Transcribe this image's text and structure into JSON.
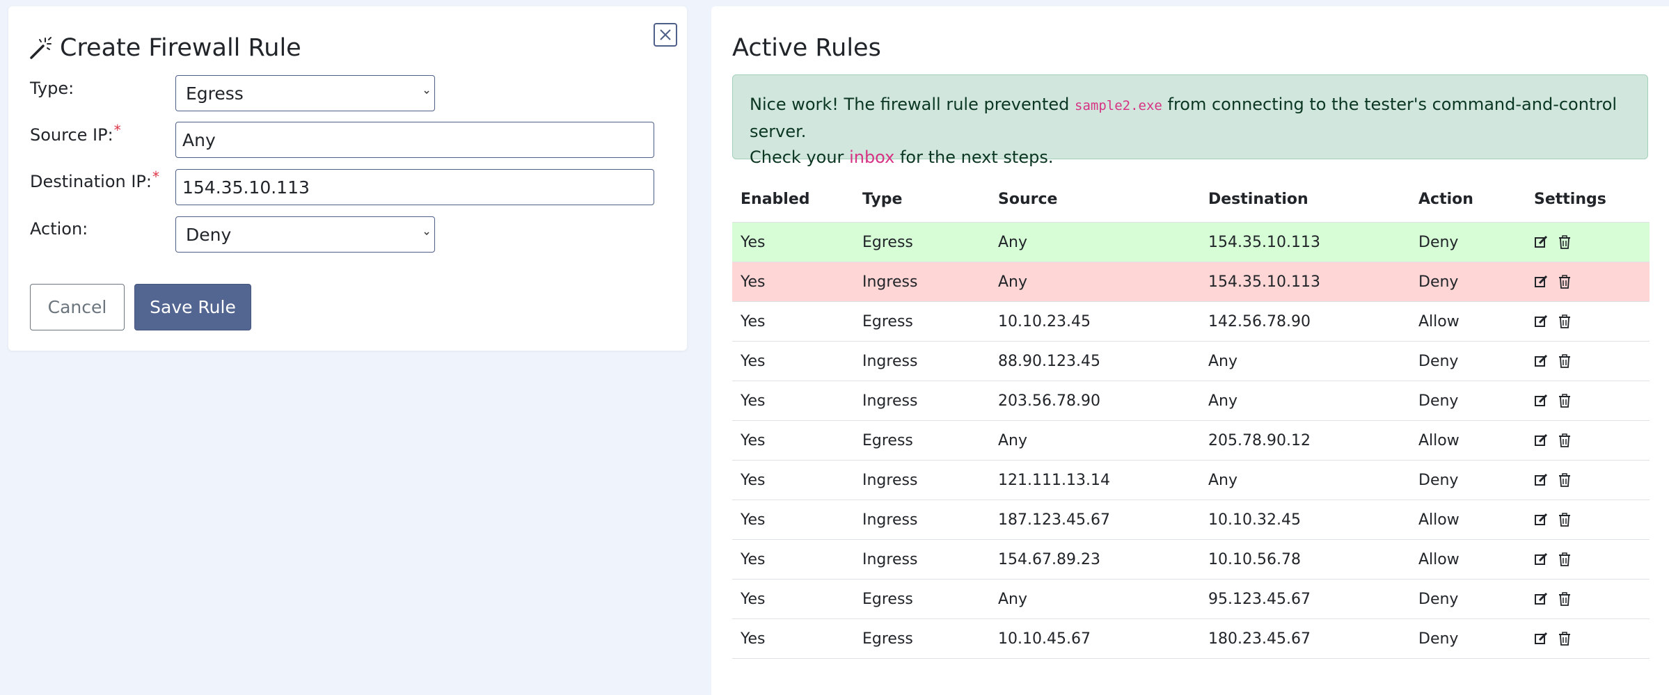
{
  "form": {
    "title": "Create Firewall Rule",
    "type_label": "Type:",
    "type_value": "Egress",
    "source_label": "Source IP:",
    "source_value": "Any",
    "dest_label": "Destination IP:",
    "dest_value": "154.35.10.113",
    "action_label": "Action:",
    "action_value": "Deny",
    "required_mark": "*",
    "cancel_label": "Cancel",
    "save_label": "Save Rule"
  },
  "rules_panel": {
    "title": "Active Rules",
    "alert": {
      "text_before": "Nice work! The firewall rule prevented ",
      "code": "sample2.exe",
      "text_after": " from connecting to the tester's command-and-control server.",
      "line2_before": "Check your ",
      "link": "inbox",
      "line2_after": " for the next steps."
    },
    "columns": [
      "Enabled",
      "Type",
      "Source",
      "Destination",
      "Action",
      "Settings"
    ],
    "rows": [
      {
        "enabled": "Yes",
        "type": "Egress",
        "source": "Any",
        "destination": "154.35.10.113",
        "action": "Deny",
        "highlight": "green"
      },
      {
        "enabled": "Yes",
        "type": "Ingress",
        "source": "Any",
        "destination": "154.35.10.113",
        "action": "Deny",
        "highlight": "red"
      },
      {
        "enabled": "Yes",
        "type": "Egress",
        "source": "10.10.23.45",
        "destination": "142.56.78.90",
        "action": "Allow",
        "highlight": ""
      },
      {
        "enabled": "Yes",
        "type": "Ingress",
        "source": "88.90.123.45",
        "destination": "Any",
        "action": "Deny",
        "highlight": ""
      },
      {
        "enabled": "Yes",
        "type": "Ingress",
        "source": "203.56.78.90",
        "destination": "Any",
        "action": "Deny",
        "highlight": ""
      },
      {
        "enabled": "Yes",
        "type": "Egress",
        "source": "Any",
        "destination": "205.78.90.12",
        "action": "Allow",
        "highlight": ""
      },
      {
        "enabled": "Yes",
        "type": "Ingress",
        "source": "121.111.13.14",
        "destination": "Any",
        "action": "Deny",
        "highlight": ""
      },
      {
        "enabled": "Yes",
        "type": "Ingress",
        "source": "187.123.45.67",
        "destination": "10.10.32.45",
        "action": "Allow",
        "highlight": ""
      },
      {
        "enabled": "Yes",
        "type": "Ingress",
        "source": "154.67.89.23",
        "destination": "10.10.56.78",
        "action": "Allow",
        "highlight": ""
      },
      {
        "enabled": "Yes",
        "type": "Egress",
        "source": "Any",
        "destination": "95.123.45.67",
        "action": "Deny",
        "highlight": ""
      },
      {
        "enabled": "Yes",
        "type": "Egress",
        "source": "10.10.45.67",
        "destination": "180.23.45.67",
        "action": "Deny",
        "highlight": ""
      }
    ]
  },
  "colors": {
    "page_bg": "#eff3fb",
    "primary": "#536591",
    "alert_bg": "#d1e7dd",
    "row_green": "#d6fdd6",
    "row_red": "#ffd6d6",
    "code_pink": "#d63384"
  },
  "icons": [
    "magic-wand-icon",
    "close-icon",
    "edit-icon",
    "trash-icon",
    "chevron-down-icon"
  ]
}
